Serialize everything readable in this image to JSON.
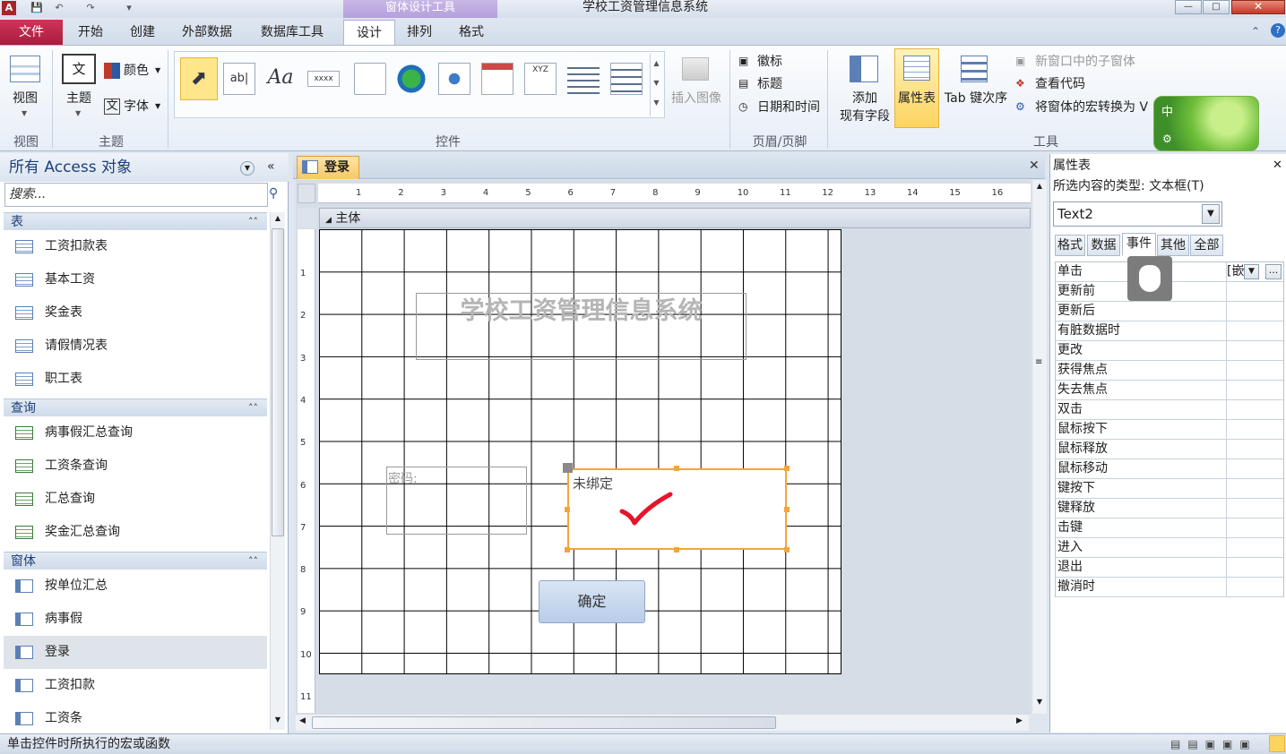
{
  "app": {
    "window_title": "学校工资管理信息系统",
    "context_tool_title": "窗体设计工具",
    "app_icon": "A"
  },
  "ribbon_tabs": [
    "开始",
    "创建",
    "外部数据",
    "数据库工具",
    "设计",
    "排列",
    "格式"
  ],
  "file_tab": "文件",
  "ribbon": {
    "view_label": "视图",
    "theme_label": "主题",
    "color_label": "颜色",
    "font_label": "字体",
    "insert_image_label": "插入图像",
    "logo_label": "徽标",
    "title_label": "标题",
    "datetime_label": "日期和时间",
    "add_fields_label_1": "添加",
    "add_fields_label_2": "现有字段",
    "property_sheet_label": "属性表",
    "tab_order_label": "Tab 键次序",
    "subform_label": "新窗口中的子窗体",
    "view_code_label": "查看代码",
    "convert_macro_label": "将窗体的宏转换为 V",
    "groups": {
      "views": "视图",
      "themes": "主题",
      "controls": "控件",
      "header_footer": "页眉/页脚",
      "tools": "工具"
    },
    "ctl_text": {
      "textbox": "ab|",
      "label": "Aa",
      "button": "xxxx",
      "option": "XYZ"
    },
    "ime_badge": "中"
  },
  "nav": {
    "header": "所有 Access 对象",
    "search_placeholder": "搜索...",
    "sections": [
      {
        "label": "表",
        "items": [
          "工资扣款表",
          "基本工资",
          "奖金表",
          "请假情况表",
          "职工表"
        ]
      },
      {
        "label": "查询",
        "items": [
          "病事假汇总查询",
          "工资条查询",
          "汇总查询",
          "奖金汇总查询"
        ]
      },
      {
        "label": "窗体",
        "items": [
          "按单位汇总",
          "病事假",
          "登录",
          "工资扣款",
          "工资条"
        ]
      }
    ],
    "selected_item": "登录"
  },
  "document": {
    "tab_label": "登录",
    "section_label": "主体",
    "ruler_h": [
      "1",
      "2",
      "3",
      "4",
      "5",
      "6",
      "7",
      "8",
      "9",
      "10",
      "11",
      "12",
      "13",
      "14",
      "15",
      "16"
    ],
    "ruler_v": [
      "1",
      "2",
      "3",
      "4",
      "5",
      "6",
      "7",
      "8",
      "9",
      "10",
      "11"
    ],
    "form_title": "学校工资管理信息系统",
    "password_label": "密码:",
    "textbox_text": "未绑定",
    "ok_button": "确定"
  },
  "property_sheet": {
    "title": "属性表",
    "selection_type": "所选内容的类型: 文本框(T)",
    "selected_control": "Text2",
    "tabs": [
      "格式",
      "数据",
      "事件",
      "其他",
      "全部"
    ],
    "active_tab": "事件",
    "rows": [
      {
        "name": "单击",
        "value": "[嵌"
      },
      {
        "name": "更新前",
        "value": ""
      },
      {
        "name": "更新后",
        "value": ""
      },
      {
        "name": "有脏数据时",
        "value": ""
      },
      {
        "name": "更改",
        "value": ""
      },
      {
        "name": "获得焦点",
        "value": ""
      },
      {
        "name": "失去焦点",
        "value": ""
      },
      {
        "name": "双击",
        "value": ""
      },
      {
        "name": "鼠标按下",
        "value": ""
      },
      {
        "name": "鼠标释放",
        "value": ""
      },
      {
        "name": "鼠标移动",
        "value": ""
      },
      {
        "name": "键按下",
        "value": ""
      },
      {
        "name": "键释放",
        "value": ""
      },
      {
        "name": "击键",
        "value": ""
      },
      {
        "name": "进入",
        "value": ""
      },
      {
        "name": "退出",
        "value": ""
      },
      {
        "name": "撤消时",
        "value": ""
      }
    ],
    "builder_button": "..."
  },
  "status_bar": {
    "text": "单击控件时所执行的宏或函数"
  },
  "colors": {
    "file_tab": "#b8264a",
    "selection_orange": "#f4a53a",
    "annotation_red": "#e8142a"
  }
}
